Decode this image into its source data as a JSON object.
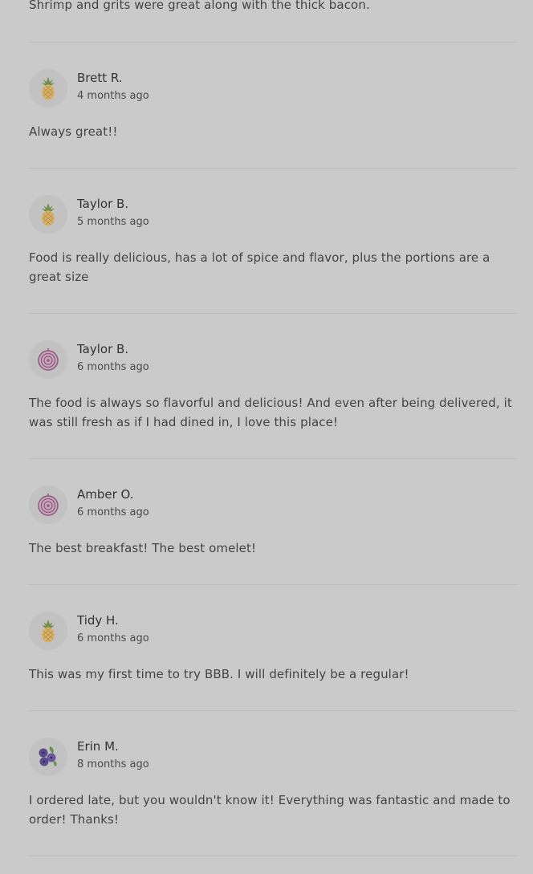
{
  "previous_review_text": "Shrimp and grits were great along with the thick bacon.",
  "reviews": [
    {
      "name": "Brett R.",
      "time": "4 months ago",
      "text": "Always great!!",
      "avatar_icon": "pineapple-icon"
    },
    {
      "name": "Taylor B.",
      "time": "5 months ago",
      "text": "Food is really delicious, has a lot of spice and flavor, plus the portions are a great size",
      "avatar_icon": "pineapple-icon"
    },
    {
      "name": "Taylor B.",
      "time": "6 months ago",
      "text": "The food is always so flavorful and delicious! And even after being delivered, it was still fresh as if I had dined in, I love this place!",
      "avatar_icon": "onion-icon"
    },
    {
      "name": "Amber O.",
      "time": "6 months ago",
      "text": "The best breakfast! The best omelet!",
      "avatar_icon": "onion-icon"
    },
    {
      "name": "Tidy H.",
      "time": "6 months ago",
      "text": "This was my first time to try BBB. I will definitely be a regular!",
      "avatar_icon": "pineapple-icon"
    },
    {
      "name": "Erin M.",
      "time": "8 months ago",
      "text": "I ordered late, but you wouldn't know it! Everything was fantastic and made to order! Thanks!",
      "avatar_icon": "blueberry-icon"
    }
  ],
  "colors": {
    "background": "#cacaca",
    "divider": "#bdbdbd",
    "pineapple": "#d9b46a",
    "onion": "#8e5a7f",
    "blueberry": "#5b4a8c"
  }
}
